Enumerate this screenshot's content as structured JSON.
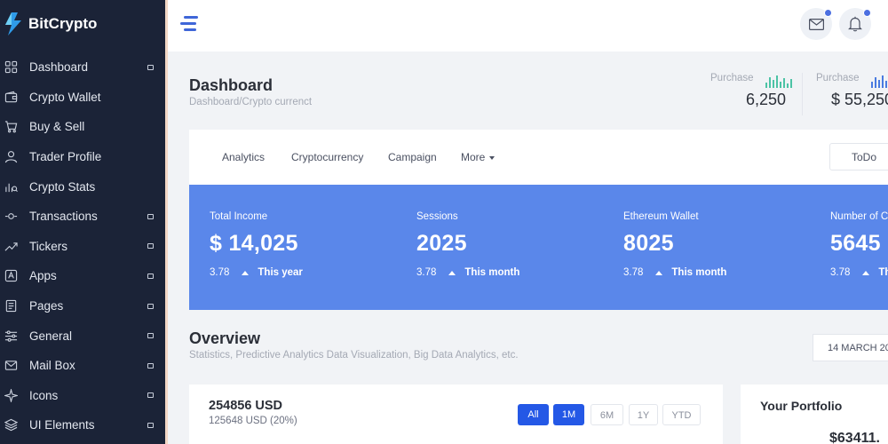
{
  "brand": {
    "name": "BitCrypto",
    "accent": "#2f9be8"
  },
  "sidebar": {
    "items": [
      {
        "label": "Dashboard",
        "icon": "grid-icon",
        "has_submenu": true
      },
      {
        "label": "Crypto Wallet",
        "icon": "wallet-icon",
        "has_submenu": false
      },
      {
        "label": "Buy & Sell",
        "icon": "cart-icon",
        "has_submenu": false
      },
      {
        "label": "Trader Profile",
        "icon": "user-icon",
        "has_submenu": false
      },
      {
        "label": "Crypto Stats",
        "icon": "stats-icon",
        "has_submenu": false
      },
      {
        "label": "Transactions",
        "icon": "transactions-icon",
        "has_submenu": true
      },
      {
        "label": "Tickers",
        "icon": "trend-icon",
        "has_submenu": true
      },
      {
        "label": "Apps",
        "icon": "apps-icon",
        "has_submenu": true
      },
      {
        "label": "Pages",
        "icon": "pages-icon",
        "has_submenu": true
      },
      {
        "label": "General",
        "icon": "sliders-icon",
        "has_submenu": true
      },
      {
        "label": "Mail Box",
        "icon": "mail-icon",
        "has_submenu": true
      },
      {
        "label": "Icons",
        "icon": "sparkle-icon",
        "has_submenu": true
      },
      {
        "label": "UI Elements",
        "icon": "layers-icon",
        "has_submenu": true
      }
    ]
  },
  "header": {
    "title": "Dashboard",
    "breadcrumb": "Dashboard/Crypto currenct",
    "purchases": [
      {
        "label": "Purchase",
        "value": "6,250",
        "bar_color": "#4cc3a5"
      },
      {
        "label": "Purchase",
        "value": "$ 55,250",
        "bar_color": "#4a7be0"
      }
    ]
  },
  "tabs": {
    "items": [
      "Analytics",
      "Cryptocurrency",
      "Campaign",
      "More"
    ],
    "todo_label": "ToDo"
  },
  "stats": {
    "background": "#5a87ea",
    "items": [
      {
        "label": "Total Income",
        "value": "$ 14,025",
        "change": "3.78",
        "period": "This year"
      },
      {
        "label": "Sessions",
        "value": "2025",
        "change": "3.78",
        "period": "This month"
      },
      {
        "label": "Ethereum Wallet",
        "value": "8025",
        "change": "3.78",
        "period": "This month"
      },
      {
        "label": "Number of Cl",
        "value": "5645",
        "change": "3.78",
        "period": "Th"
      }
    ]
  },
  "overview": {
    "title": "Overview",
    "subtitle": "Statistics, Predictive Analytics Data Visualization, Big Data Analytics, etc.",
    "date": "14 MARCH 20"
  },
  "balance": {
    "amount": "254856 USD",
    "sub": "125648 USD (20%)",
    "ranges": [
      {
        "label": "All",
        "active": true
      },
      {
        "label": "1M",
        "active": true
      },
      {
        "label": "6M",
        "active": false
      },
      {
        "label": "1Y",
        "active": false
      },
      {
        "label": "YTD",
        "active": false
      }
    ]
  },
  "portfolio": {
    "title": "Your Portfolio",
    "value": "$63411."
  }
}
